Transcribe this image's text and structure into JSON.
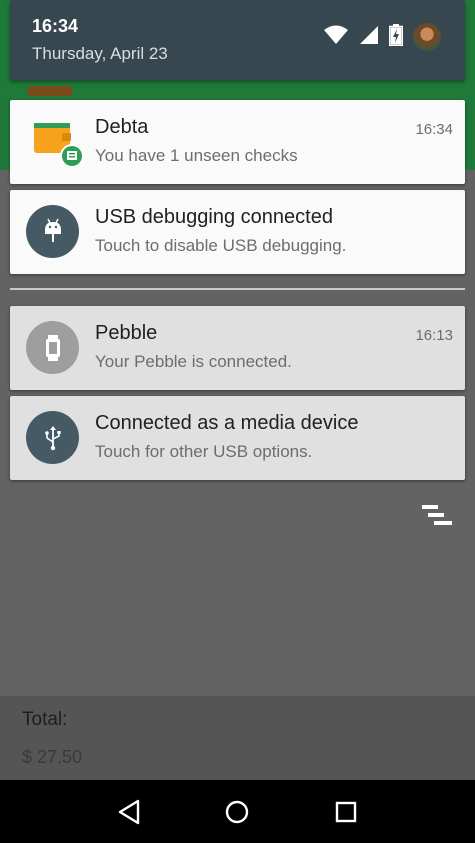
{
  "status": {
    "time": "16:34",
    "date": "Thursday, April 23",
    "icons": [
      "wifi-icon",
      "cell-signal-icon",
      "battery-charging-icon",
      "avatar"
    ]
  },
  "notifications": [
    {
      "app": "Debta",
      "text": "You have 1 unseen checks",
      "time": "16:34",
      "icon": "wallet-icon"
    },
    {
      "app": "USB debugging connected",
      "text": "Touch to disable USB debugging.",
      "time": "",
      "icon": "android-icon"
    },
    {
      "app": "Pebble",
      "text": "Your Pebble is connected.",
      "time": "16:13",
      "icon": "watch-icon"
    },
    {
      "app": "Connected as a media device",
      "text": "Touch for other USB options.",
      "time": "",
      "icon": "usb-icon"
    }
  ],
  "background_app": {
    "total_label": "Total:",
    "total_value": "$ 27.50"
  },
  "navbar": {
    "icons": [
      "back-icon",
      "home-icon",
      "recents-icon"
    ]
  },
  "colors": {
    "header": "#37474f",
    "icon_circle_blue": "#455a64",
    "icon_circle_grey": "#9e9e9e",
    "accent_green": "#2e9d55"
  }
}
